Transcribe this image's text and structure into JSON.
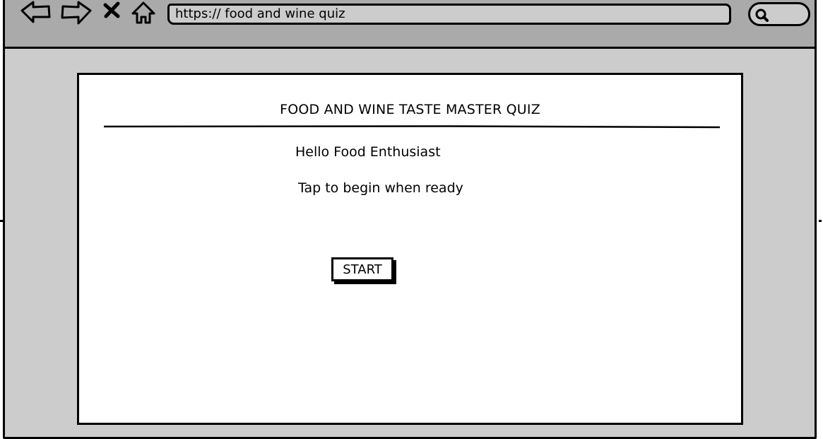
{
  "browser": {
    "url": "https:// food and wine quiz",
    "nav_icons": [
      "back-arrow-icon",
      "forward-arrow-icon",
      "close-icon",
      "home-icon"
    ],
    "search_icon": "search-icon"
  },
  "page": {
    "title": "FOOD AND WINE TASTE MASTER QUIZ",
    "greeting": "Hello Food Enthusiast",
    "instruction": "Tap to begin when ready",
    "start_label": "START"
  },
  "colors": {
    "toolbar": "#aaaaaa",
    "frame": "#cccccc",
    "panel": "#ffffff",
    "ink": "#000000"
  }
}
